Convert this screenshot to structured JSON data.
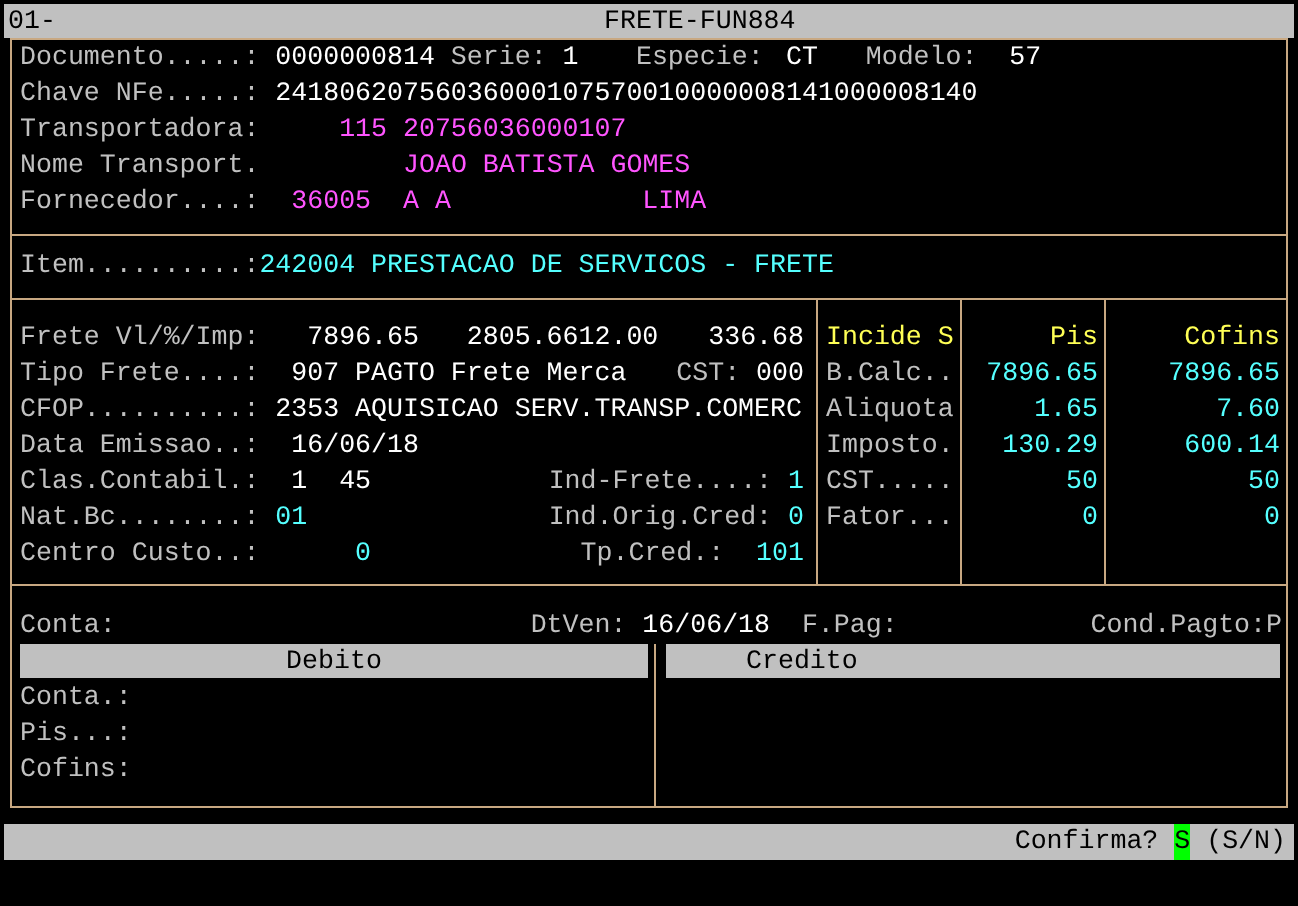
{
  "title_bar": {
    "code": "01-",
    "title": "FRETE-FUN884"
  },
  "header": {
    "documento": {
      "label": "Documento.....:",
      "value": "0000000814"
    },
    "serie": {
      "label": "Serie:",
      "value": "1"
    },
    "especie": {
      "label": "Especie:",
      "value": "CT"
    },
    "modelo": {
      "label": "Modelo:",
      "value": "57"
    },
    "chave": {
      "label": "Chave NFe.....:",
      "value": "24180620756036000107570010000008141000008140"
    },
    "transportadora": {
      "label": "Transportadora:",
      "code": "115",
      "cnpj": "20756036000107"
    },
    "nome_transport": {
      "label": "Nome Transport.",
      "value": "JOAO BATISTA GOMES"
    },
    "fornecedor": {
      "label": "Fornecedor....:",
      "code": "36005",
      "name": "A A",
      "city": "LIMA"
    }
  },
  "item": {
    "label": "Item..........:",
    "value": "242004 PRESTACAO DE SERVICOS - FRETE"
  },
  "freight": {
    "frete": {
      "label": "Frete Vl/%/Imp:",
      "values": [
        "7896.65",
        "2805.66",
        "12.00",
        "336.68"
      ]
    },
    "tipo_frete": {
      "label": "Tipo Frete....:",
      "value": "907 PAGTO Frete Merca",
      "cst_label": "CST:",
      "cst": "000"
    },
    "cfop": {
      "label": "CFOP..........:",
      "value": "2353 AQUISICAO SERV.TRANSP.COMERC"
    },
    "data_emissao": {
      "label": "Data Emissao..:",
      "value": "16/06/18"
    },
    "clas_contabil": {
      "label": "Clas.Contabil.:",
      "values": [
        "1",
        "45"
      ],
      "ind_label": "Ind-Frete....:",
      "ind": "1"
    },
    "nat_bc": {
      "label": "Nat.Bc........:",
      "value": "01",
      "ind_label": "Ind.Orig.Cred:",
      "ind": "0"
    },
    "centro_custo": {
      "label": "Centro Custo..:",
      "value": "0",
      "cred_label": "Tp.Cred.:",
      "cred": "101"
    }
  },
  "tax_table": {
    "columns": [
      "Incide S",
      "Pis",
      "Cofins"
    ],
    "rows": [
      {
        "label": "B.Calc..",
        "pis": "7896.65",
        "cofins": "7896.65"
      },
      {
        "label": "Aliquota",
        "pis": "1.65",
        "cofins": "7.60"
      },
      {
        "label": "Imposto.",
        "pis": "130.29",
        "cofins": "600.14"
      },
      {
        "label": "CST.....",
        "pis": "50",
        "cofins": "50"
      },
      {
        "label": "Fator...",
        "pis": "0",
        "cofins": "0"
      }
    ]
  },
  "payment": {
    "conta_label": "Conta:",
    "dtven_label": "DtVen:",
    "dtven": "16/06/18",
    "fpag_label": "F.Pag:",
    "cond_pagto": "Cond.Pagto:P"
  },
  "entries": {
    "debito": {
      "title": "Debito",
      "labels": [
        "Conta.:",
        "Pis...:",
        "Cofins:"
      ]
    },
    "credito": {
      "title": "Credito"
    }
  },
  "status_bar": {
    "prompt": "Confirma?",
    "answer": "S",
    "options": "(S/N)"
  }
}
